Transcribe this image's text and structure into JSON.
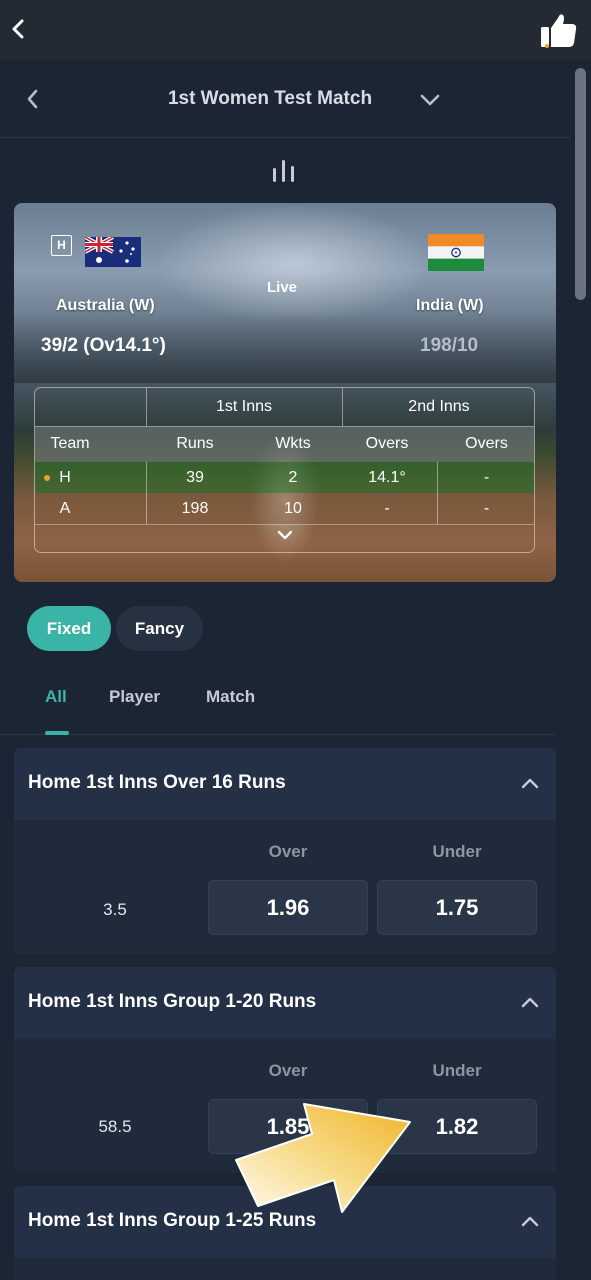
{
  "app": {
    "accent": "#3bb4a8",
    "background": "#1c2534"
  },
  "topbar": {
    "back_icon": "chevron-left-icon",
    "like_icon": "thumbs-up-icon"
  },
  "header": {
    "title": "1st Women Test Match"
  },
  "scoreboard": {
    "home_badge": "H",
    "status": "Live",
    "home": {
      "name": "Australia (W)",
      "score": "39/2 (Ov14.1°)"
    },
    "away": {
      "name": "India (W)",
      "score": "198/10"
    },
    "table": {
      "group_headers": [
        "1st Inns",
        "2nd Inns"
      ],
      "columns": [
        "Team",
        "Runs",
        "Wkts",
        "Overs",
        "Overs"
      ],
      "rows": [
        [
          "H",
          "39",
          "2",
          "14.1°",
          "-"
        ],
        [
          "A",
          "198",
          "10",
          "-",
          "-"
        ]
      ]
    }
  },
  "chips": {
    "fixed": "Fixed",
    "fancy": "Fancy"
  },
  "tabs": [
    "All",
    "Player",
    "Match"
  ],
  "markets": [
    {
      "title": "Home 1st Inns Over 16 Runs",
      "over_label": "Over",
      "under_label": "Under",
      "line": "3.5",
      "over": "1.96",
      "under": "1.75"
    },
    {
      "title": "Home 1st Inns Group 1-20 Runs",
      "over_label": "Over",
      "under_label": "Under",
      "line": "58.5",
      "over": "1.85",
      "under": "1.82"
    },
    {
      "title": "Home 1st Inns Group 1-25 Runs"
    }
  ]
}
